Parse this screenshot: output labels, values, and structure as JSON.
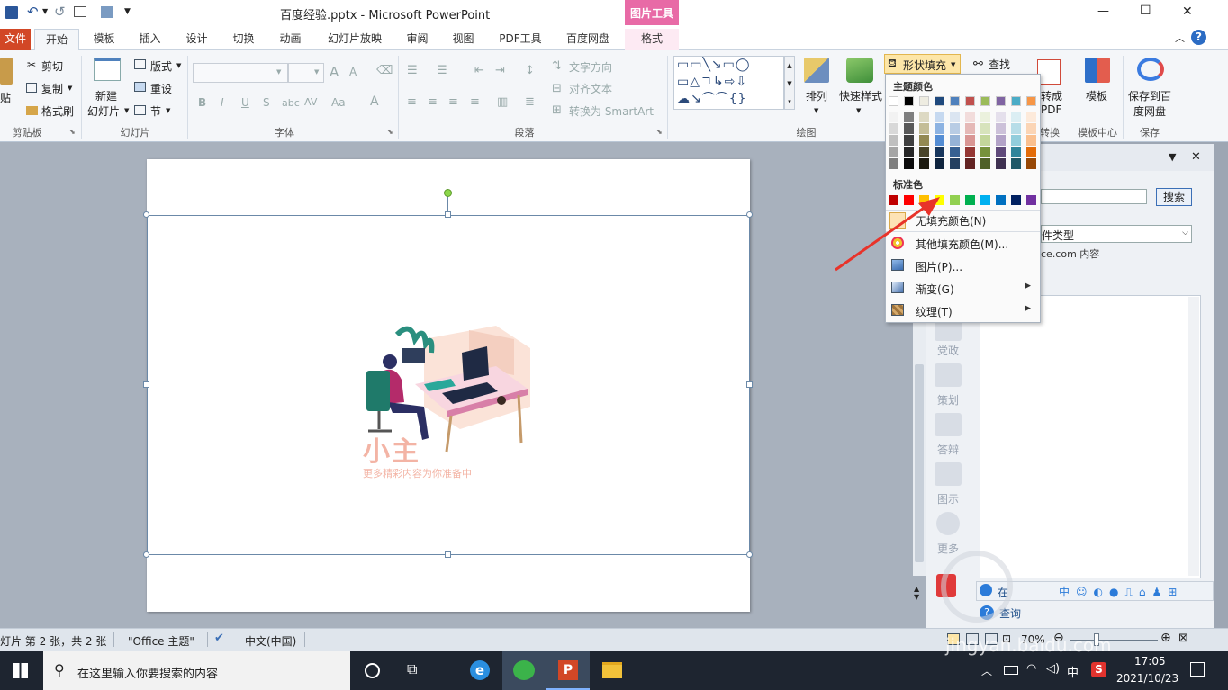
{
  "window": {
    "title": "百度经验.pptx - Microsoft PowerPoint",
    "context_tab": "图片工具"
  },
  "quick_access": {
    "save_icon": "save-icon",
    "undo_icon": "undo-icon",
    "redo_icon": "redo-icon"
  },
  "window_controls": {
    "minimize": "—",
    "maximize": "☐",
    "close": "✕"
  },
  "tabs": [
    "文件",
    "开始",
    "模板",
    "插入",
    "设计",
    "切换",
    "动画",
    "幻灯片放映",
    "审阅",
    "视图",
    "PDF工具",
    "百度网盘",
    "格式"
  ],
  "ribbon": {
    "clipboard": {
      "paste": "粘贴",
      "cut": "剪切",
      "copy": "复制",
      "format_painter": "格式刷",
      "group": "剪贴板"
    },
    "slides": {
      "new_slide_1": "新建",
      "new_slide_2": "幻灯片",
      "layout": "版式",
      "reset": "重设",
      "section": "节",
      "group": "幻灯片"
    },
    "font": {
      "group": "字体",
      "bold": "B",
      "italic": "I",
      "underline": "U",
      "shadow": "S",
      "strike": "abc",
      "spacing": "AV",
      "case": "Aa",
      "grow": "A",
      "shrink": "A",
      "color": "A"
    },
    "paragraph": {
      "group": "段落",
      "text_direction": "文字方向",
      "align_text": "对齐文本",
      "convert_smartart": "转换为 SmartArt"
    },
    "drawing": {
      "group": "绘图",
      "arrange": "排列",
      "quick_styles": "快速样式",
      "shape_fill": "形状填充",
      "find": "查找"
    },
    "pdf": {
      "create_pdf_1": "转成",
      "create_pdf_2": "PDF",
      "group": "转换"
    },
    "templates": {
      "label": "模板",
      "group": "模板中心"
    },
    "save": {
      "label_1": "保存到百",
      "label_2": "度网盘",
      "group": "保存"
    }
  },
  "dropdown": {
    "theme_colors_title": "主题颜色",
    "theme_top_row": [
      "#ffffff",
      "#000000",
      "#eeece1",
      "#1f497d",
      "#4f81bd",
      "#c0504d",
      "#9bbb59",
      "#8064a2",
      "#4bacc6",
      "#f79646"
    ],
    "theme_shades": [
      [
        "#f2f2f2",
        "#7f7f7f",
        "#ddd9c3",
        "#c6d9f0",
        "#dbe5f1",
        "#f2dcdb",
        "#ebf1dd",
        "#e5e0ec",
        "#dbeef3",
        "#fdeada"
      ],
      [
        "#d8d8d8",
        "#595959",
        "#c4bd97",
        "#8db3e2",
        "#b8cce4",
        "#e5b9b7",
        "#d7e3bc",
        "#ccc1d9",
        "#b7dde8",
        "#fbd5b5"
      ],
      [
        "#bfbfbf",
        "#3f3f3f",
        "#938953",
        "#548dd4",
        "#95b3d7",
        "#d99694",
        "#c3d69b",
        "#b2a2c7",
        "#92cddc",
        "#fac08f"
      ],
      [
        "#a5a5a5",
        "#262626",
        "#494429",
        "#17365d",
        "#366092",
        "#953734",
        "#76923c",
        "#5f497a",
        "#31859b",
        "#e36c09"
      ],
      [
        "#7f7f7f",
        "#0c0c0c",
        "#1d1b10",
        "#0f243e",
        "#244061",
        "#632423",
        "#4f6128",
        "#3f3151",
        "#205867",
        "#974806"
      ]
    ],
    "standard_title": "标准色",
    "standard_colors": [
      "#c00000",
      "#ff0000",
      "#ffc000",
      "#ffff00",
      "#92d050",
      "#00b050",
      "#00b0f0",
      "#0070c0",
      "#002060",
      "#7030a0"
    ],
    "no_fill": "无填充颜色(N)",
    "more_colors": "其他填充颜色(M)...",
    "picture": "图片(P)...",
    "gradient": "渐变(G)",
    "texture": "纹理(T)"
  },
  "slide": {
    "logo_text": "小主",
    "logo_subtitle": "更多精彩内容为你准备中"
  },
  "panel": {
    "search_button": "搜索",
    "type_select": "件类型",
    "note": "ce.com 内容",
    "nav": [
      "党政",
      "策划",
      "答辩",
      "图示",
      "更多"
    ],
    "bottom_text_1": "在",
    "bottom_text_2": "查询"
  },
  "status": {
    "slide_info": "灯片 第 2 张，共 2 张",
    "theme": "\"Office 主题\"",
    "language": "中文(中国)",
    "zoom": "70%"
  },
  "taskbar": {
    "search_placeholder": "在这里输入你要搜索的内容",
    "time": "17:05",
    "date": "2021/10/23",
    "ime": "中"
  },
  "watermark": {
    "text": "jingyan.baidu.com"
  }
}
